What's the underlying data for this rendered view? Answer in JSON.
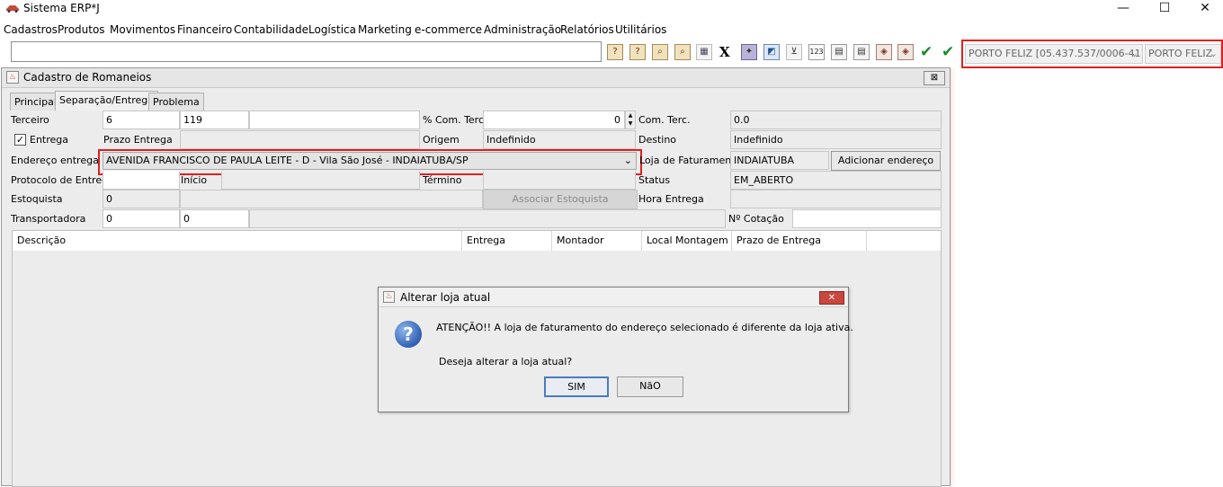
{
  "window": {
    "title": "Sistema ERP*J"
  },
  "menu": [
    "Cadastros",
    "Produtos",
    "Movimentos",
    "Financeiro",
    "Contabilidade",
    "Logística",
    "Marketing",
    "e-commerce",
    "Administração",
    "Relatórios",
    "Utilitários"
  ],
  "toolbar": {
    "store_select": "PORTO FELIZ [05.437.537/0006-41]",
    "store_select2": "PORTO FELIZ"
  },
  "frame": {
    "title": "Cadastro de Romaneios",
    "close": "⊠"
  },
  "tabs": [
    "Principal",
    "Separação/Entrega",
    "Problema"
  ],
  "form": {
    "terceiro_label": "Terceiro",
    "terceiro_code": "6",
    "terceiro_num": "119",
    "com_terc_pct_label": "% Com. Terc.",
    "com_terc_pct_value": "0",
    "com_terc_label": "Com. Terc.",
    "com_terc_value": "0.0",
    "entrega_label": "Entrega",
    "prazo_entrega_label": "Prazo Entrega",
    "origem_label": "Origem",
    "origem_value": "Indefinido",
    "destino_label": "Destino",
    "destino_value": "Indefinido",
    "endereco_label": "Endereço entrega",
    "endereco_value": "AVENIDA FRANCISCO DE PAULA LEITE - D - Vila São José - INDAIATUBA/SP",
    "loja_fat_label": "Loja de Faturamento",
    "loja_fat_value": "INDAIATUBA",
    "adicionar_endereco": "Adicionar endereço",
    "protocolo_label": "Protocolo de Entrega",
    "inicio_label": "Início",
    "termino_label": "Término",
    "status_label": "Status",
    "status_value": "EM_ABERTO",
    "estoquista_label": "Estoquista",
    "estoquista_value": "0",
    "associar_estoquista": "Associar Estoquista",
    "hora_entrega_label": "Hora Entrega",
    "transportadora_label": "Transportadora",
    "transp_code": "0",
    "transp_num": "0",
    "cotacao_label": "Nº Cotação"
  },
  "table": {
    "columns": [
      "Descrição",
      "Entrega",
      "Montador",
      "Local Montagem",
      "Prazo de Entrega"
    ]
  },
  "dialog": {
    "title": "Alterar loja atual",
    "message": "ATENÇÃO!! A loja de faturamento do endereço selecionado é diferente da loja ativa.",
    "question": "Deseja alterar a loja atual?",
    "yes": "SIM",
    "no": "NãO"
  }
}
